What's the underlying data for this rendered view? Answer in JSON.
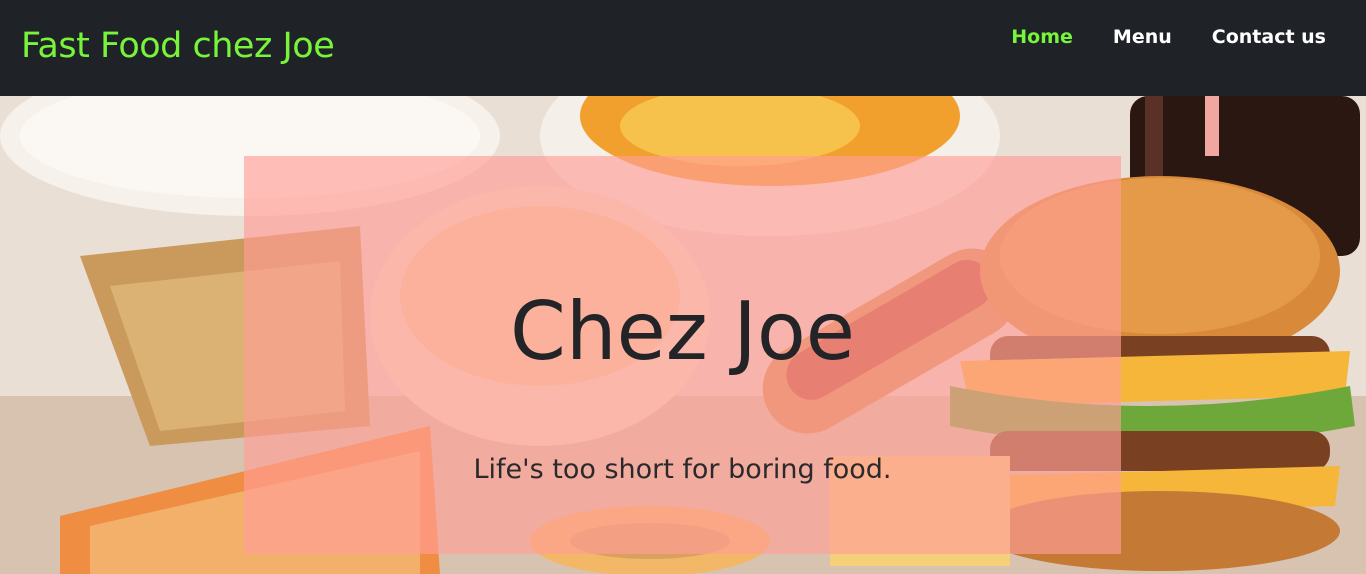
{
  "navbar": {
    "brand": "Fast Food chez Joe",
    "links": [
      {
        "label": "Home",
        "active": true
      },
      {
        "label": "Menu",
        "active": false
      },
      {
        "label": "Contact us",
        "active": false
      }
    ]
  },
  "hero": {
    "title": "Chez Joe",
    "tagline": "Life's too short for boring food."
  },
  "colors": {
    "navbar_bg": "#1f2327",
    "brand_green": "#78f53a",
    "overlay": "#ff9e96"
  }
}
